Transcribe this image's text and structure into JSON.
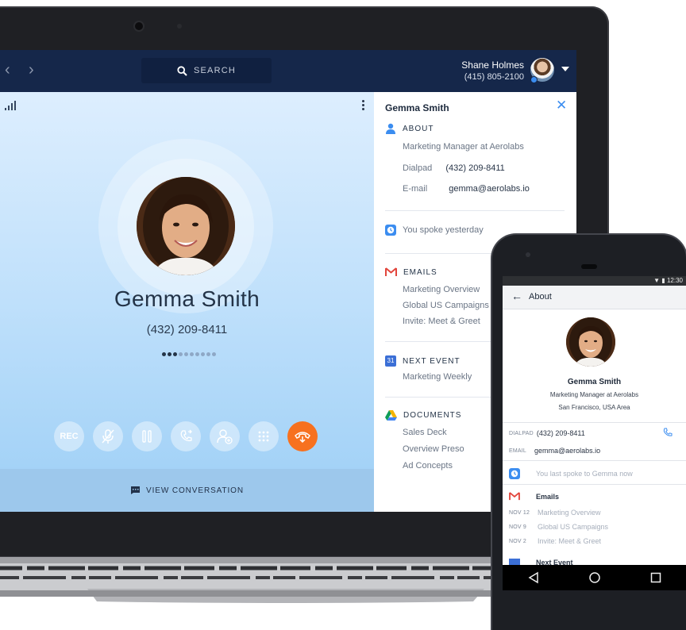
{
  "header": {
    "search_label": "SEARCH",
    "user_name": "Shane Holmes",
    "user_phone": "(415) 805-2100"
  },
  "call": {
    "name": "Gemma Smith",
    "phone": "(432) 209-8411",
    "progress": {
      "filled": 3,
      "total": 10
    },
    "controls": {
      "rec": "REC",
      "mute": "mute-mic-icon",
      "hold": "pause-icon",
      "transfer": "transfer-icon",
      "add_person": "add-person-icon",
      "keypad": "keypad-icon",
      "hangup": "hang-up-icon"
    },
    "view_conversation": "VIEW CONVERSATION",
    "hangup_color": "#f7711f"
  },
  "sidebar": {
    "name": "Gemma Smith",
    "about": {
      "title": "ABOUT",
      "role": "Marketing Manager at Aerolabs",
      "dialpad_label": "Dialpad",
      "dialpad_value": "(432) 209-8411",
      "email_label": "E-mail",
      "email_value": "gemma@aerolabs.io"
    },
    "last_spoke": "You spoke yesterday",
    "emails": {
      "title": "EMAILS",
      "items": [
        "Marketing Overview",
        "Global US Campaigns",
        "Invite: Meet & Greet"
      ]
    },
    "next_event": {
      "title": "NEXT EVENT",
      "badge": "31",
      "item": "Marketing Weekly"
    },
    "documents": {
      "title": "DOCUMENTS",
      "items": [
        "Sales Deck",
        "Overview Preso",
        "Ad Concepts"
      ]
    }
  },
  "phone": {
    "status_time": "12:30",
    "title": "About",
    "name": "Gemma Smith",
    "role": "Marketing Manager at Aerolabs",
    "location": "San Francisco, USA Area",
    "dialpad_label": "DIALPAD",
    "dialpad_value": "(432) 209-8411",
    "email_label": "EMAIL",
    "email_value": "gemma@aerolabs.io",
    "last_spoke": "You last spoke to Gemma now",
    "emails_title": "Emails",
    "emails": [
      {
        "date": "NOV 12",
        "subject": "Marketing Overview"
      },
      {
        "date": "NOV 9",
        "subject": "Global US Campaigns"
      },
      {
        "date": "NOV 2",
        "subject": "Invite: Meet & Greet"
      }
    ],
    "next_event_title": "Next Event"
  },
  "colors": {
    "topbar": "#15274a",
    "accent_blue": "#3b8df0",
    "hangup_orange": "#f7711f"
  }
}
